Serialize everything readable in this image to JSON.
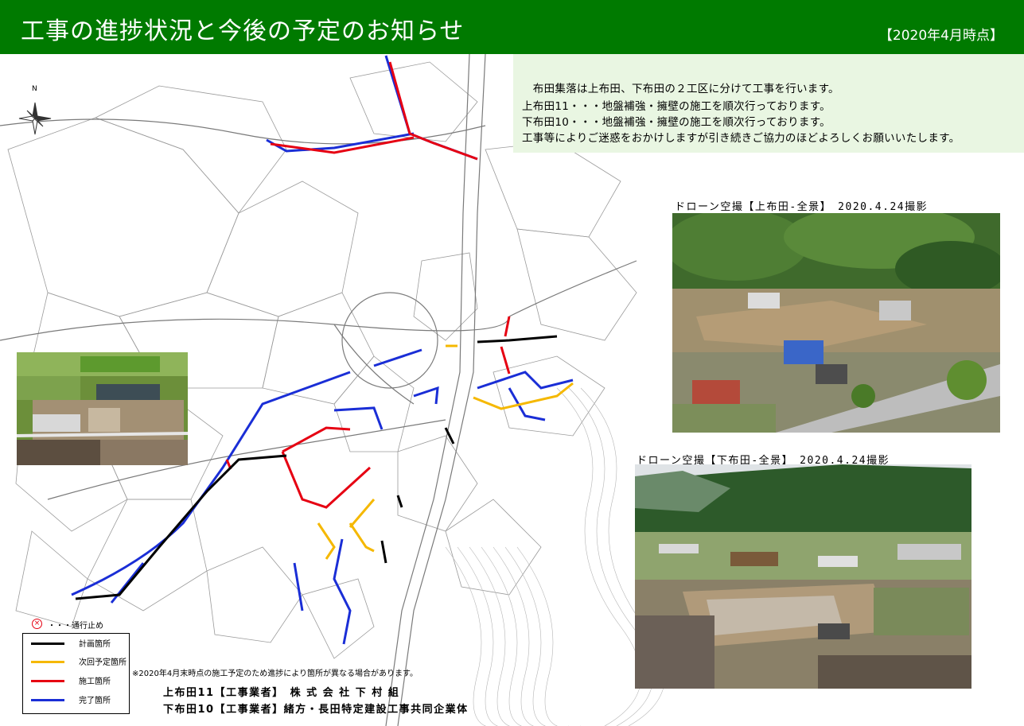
{
  "header": {
    "title": "工事の進捗状況と今後の予定のお知らせ",
    "date": "【2020年4月時点】"
  },
  "notice": {
    "lines": [
      "　布田集落は上布田、下布田の２工区に分けて工事を行います。",
      "上布田11・・・地盤補強・擁壁の施工を順次行っております。",
      "下布田10・・・地盤補強・擁壁の施工を順次行っております。",
      "工事等によりご迷惑をおかけしますが引き続きご協力のほどよろしくお願いいたします。"
    ]
  },
  "compass": {
    "label": "N"
  },
  "photos": {
    "upper_label": "ドローン空撮【上布田-全景】　2020.4.24撮影",
    "lower_label": "ドローン空撮【下布田-全景】　2020.4.24撮影"
  },
  "legend": {
    "closure_label": "・・・通行止め",
    "items": [
      {
        "label": "計画箇所",
        "color": "#000000"
      },
      {
        "label": "次回予定箇所",
        "color": "#f5b800"
      },
      {
        "label": "施工箇所",
        "color": "#e60012"
      },
      {
        "label": "完了箇所",
        "color": "#1a2ed6"
      }
    ]
  },
  "note": "※2020年4月末時点の施工予定のため進捗により箇所が異なる場合があります。",
  "contractors": [
    "上布田11【工事業者】　株 式 会 社 下 村 組",
    "下布田10【工事業者】緒方・長田特定建設工事共同企業体"
  ],
  "colors": {
    "header_bg": "#007a00",
    "notice_bg": "#e9f6e2",
    "planned": "#000000",
    "next": "#f5b800",
    "in_progress": "#e60012",
    "completed": "#1a2ed6"
  }
}
